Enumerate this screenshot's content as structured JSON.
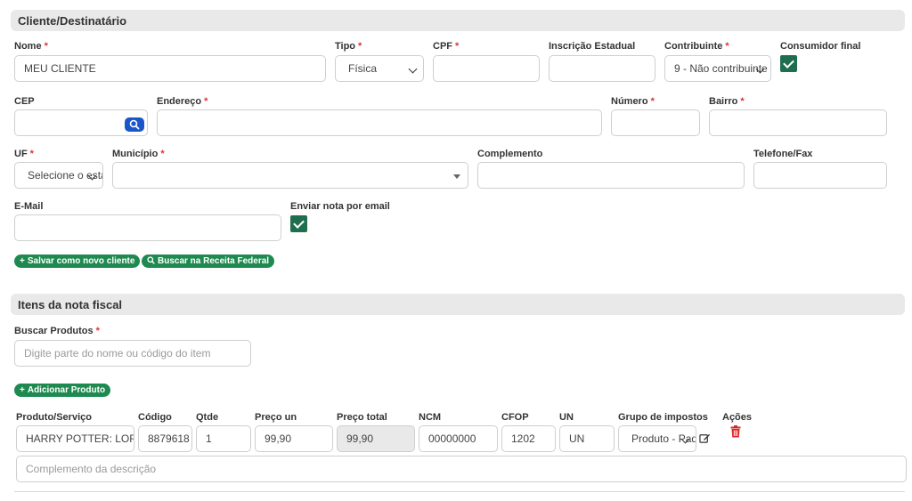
{
  "client_section": {
    "title": "Cliente/Destinatário",
    "nome": {
      "label": "Nome",
      "value": "MEU CLIENTE"
    },
    "tipo": {
      "label": "Tipo",
      "value": "Física"
    },
    "cpf": {
      "label": "CPF",
      "value": ""
    },
    "inscricao": {
      "label": "Inscrição Estadual",
      "value": ""
    },
    "contribuinte": {
      "label": "Contribuinte",
      "value": "9 - Não contribuinte"
    },
    "consumidor": {
      "label": "Consumidor final",
      "checked": true
    },
    "cep": {
      "label": "CEP",
      "value": ""
    },
    "endereco": {
      "label": "Endereço",
      "value": ""
    },
    "numero": {
      "label": "Número",
      "value": ""
    },
    "bairro": {
      "label": "Bairro",
      "value": ""
    },
    "uf": {
      "label": "UF",
      "value": "Selecione o estado"
    },
    "municipio": {
      "label": "Município",
      "value": ""
    },
    "complemento": {
      "label": "Complemento",
      "value": ""
    },
    "telefone": {
      "label": "Telefone/Fax",
      "value": ""
    },
    "email": {
      "label": "E-Mail",
      "value": ""
    },
    "enviar_email": {
      "label": "Enviar nota por email",
      "checked": true
    },
    "buttons": {
      "salvar": "Salvar como novo cliente",
      "buscar_receita": "Buscar na Receita Federal"
    }
  },
  "items_section": {
    "title": "Itens da nota fiscal",
    "buscar": {
      "label": "Buscar Produtos",
      "placeholder": "Digite parte do nome ou código do item"
    },
    "add_button": "Adicionar Produto",
    "columns": [
      "Produto/Serviço",
      "Código",
      "Qtde",
      "Preço un",
      "Preço total",
      "NCM",
      "CFOP",
      "UN",
      "Grupo de impostos",
      "Ações"
    ],
    "row": {
      "produto": "HARRY POTTER: LORD VOLDEMORT",
      "codigo": "8879618",
      "qtde": "1",
      "preco_un": "99,90",
      "preco_total": "99,90",
      "ncm": "00000000",
      "cfop": "1202",
      "un": "UN",
      "grupo": "Produto - Padrão"
    },
    "complemento_placeholder": "Complemento da descrição"
  },
  "colors": {
    "accent_green": "#1e8a4f",
    "checkbox_green": "#1f6e4e",
    "search_blue": "#1a56c9",
    "danger_red": "#d9262b"
  }
}
